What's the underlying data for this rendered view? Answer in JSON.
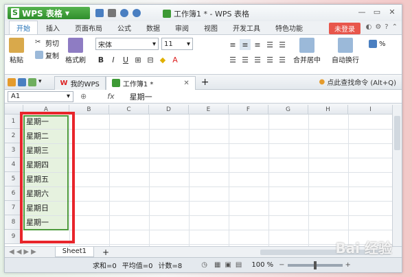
{
  "app": {
    "button_label": "WPS 表格",
    "logo_char": "S",
    "window_title": "工作簿1 * - WPS 表格"
  },
  "menu": {
    "tabs": [
      "开始",
      "插入",
      "页面布局",
      "公式",
      "数据",
      "审阅",
      "视图",
      "开发工具",
      "特色功能"
    ],
    "login": "未登录"
  },
  "ribbon": {
    "paste": "粘贴",
    "cut": "剪切",
    "copy": "复制",
    "format_painter": "格式刷",
    "font_name": "宋体",
    "font_size": "11",
    "merge_center": "合并居中",
    "wrap_text": "自动换行",
    "percent": "%"
  },
  "doctabs": {
    "my_wps": "我的WPS",
    "workbook": "工作簿1 *",
    "search_cmd": "点此查找命令 (Alt+Q)"
  },
  "formula_bar": {
    "name_box": "A1",
    "fx": "fx",
    "value": "星期一"
  },
  "grid": {
    "columns": [
      "A",
      "B",
      "C",
      "D",
      "E",
      "F",
      "G",
      "H",
      "I"
    ],
    "rows": [
      "1",
      "2",
      "3",
      "4",
      "5",
      "6",
      "7",
      "8",
      "9"
    ],
    "col_a_values": [
      "星期一",
      "星期二",
      "星期三",
      "星期四",
      "星期五",
      "星期六",
      "星期日",
      "星期一"
    ]
  },
  "sheet_tabs": {
    "active": "Sheet1",
    "add": "+"
  },
  "status": {
    "sum": "求和=0",
    "avg": "平均值=0",
    "count": "计数=8",
    "zoom": "100 %"
  },
  "watermark": "Bai 经验"
}
